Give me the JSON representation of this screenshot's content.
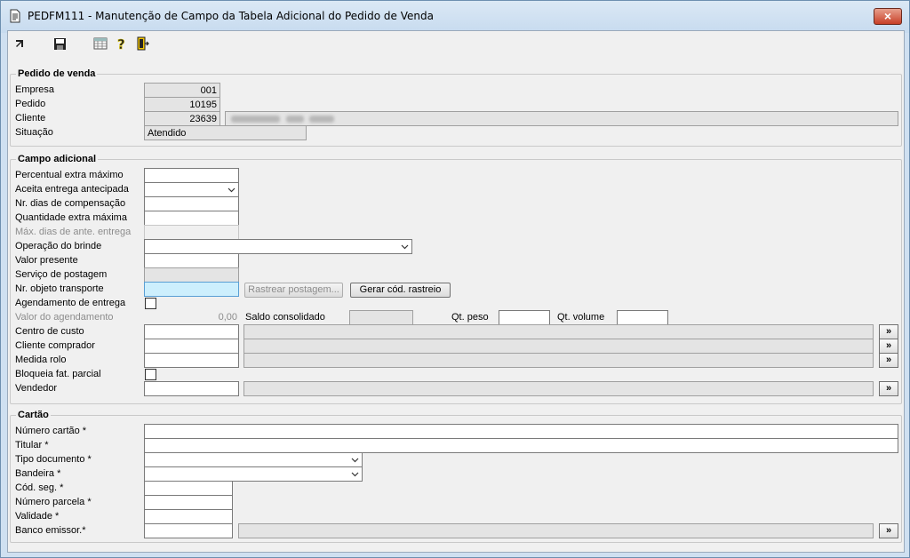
{
  "window": {
    "title": "PEDFM111 - Manutenção de Campo da Tabela Adicional do Pedido de Venda",
    "close_label": "×"
  },
  "toolbar": {
    "icons": [
      "pointer-icon",
      "save-icon",
      "grid-icon",
      "help-icon",
      "exit-icon"
    ]
  },
  "pedido": {
    "legend": "Pedido de venda",
    "empresa_label": "Empresa",
    "empresa_value": "001",
    "pedido_label": "Pedido",
    "pedido_value": "10195",
    "cliente_label": "Cliente",
    "cliente_value": "23639",
    "situacao_label": "Situação",
    "situacao_value": "Atendido"
  },
  "campo": {
    "legend": "Campo adicional",
    "percentual_label": "Percentual extra máximo",
    "aceita_label": "Aceita entrega antecipada",
    "nr_dias_label": "Nr. dias de compensação",
    "quantidade_label": "Quantidade extra máxima",
    "max_dias_label": "Máx. dias de ante. entrega",
    "operacao_label": "Operação do brinde",
    "valor_presente_label": "Valor presente",
    "servico_label": "Serviço de postagem",
    "nr_objeto_label": "Nr. objeto transporte",
    "rastrear_button": "Rastrear postagem...",
    "gerar_button": "Gerar cód. rastreio",
    "agendamento_label": "Agendamento de entrega",
    "valor_agendamento_label": "Valor do agendamento",
    "valor_agendamento_value": "0,00",
    "saldo_label": "Saldo consolidado",
    "qt_peso_label": "Qt. peso",
    "qt_volume_label": "Qt. volume",
    "centro_label": "Centro de custo",
    "cliente_comprador_label": "Cliente comprador",
    "medida_label": "Medida rolo",
    "bloqueia_label": "Bloqueia fat. parcial",
    "vendedor_label": "Vendedor",
    "lookup_label": "»"
  },
  "cartao": {
    "legend": "Cartão",
    "numero_label": "Número cartão *",
    "titular_label": "Titular *",
    "tipo_label": "Tipo documento *",
    "bandeira_label": "Bandeira *",
    "cod_seg_label": "Cód. seg. *",
    "parcela_label": "Número parcela *",
    "validade_label": "Validade *",
    "banco_label": "Banco emissor.*"
  }
}
